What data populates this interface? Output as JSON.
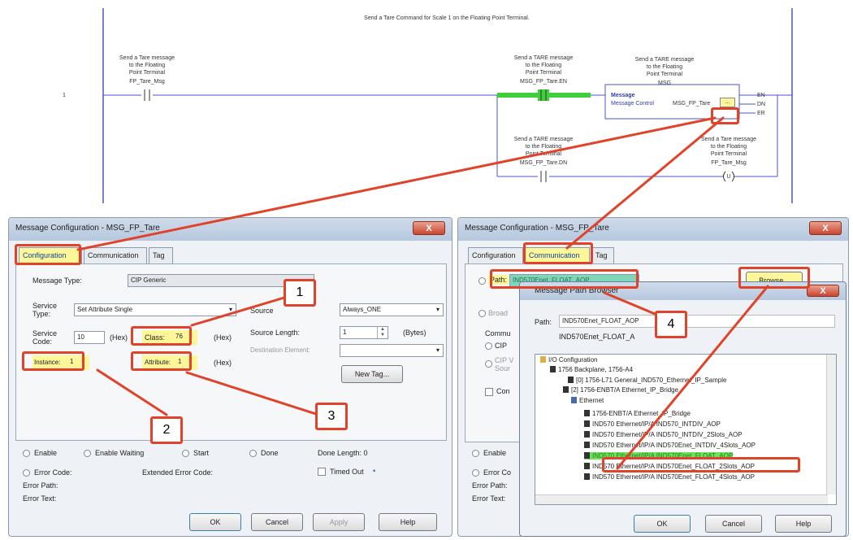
{
  "ladder": {
    "rung_comment": "Send a Tare Command for Scale 1 on the Floating Point Terminal.",
    "rung_number": "1",
    "xic1": {
      "desc": [
        "Send a Tare message",
        "to the Floating",
        "Point Terminal"
      ],
      "tag": "FP_Tare_Msg"
    },
    "xic2": {
      "desc": [
        "Send a TARE message",
        "to the Floating",
        "Point Terminal"
      ],
      "tag": "MSG_FP_Tare.EN"
    },
    "msg_block": {
      "desc": [
        "Send a TARE message",
        "to the Floating",
        "Point Terminal"
      ],
      "title": "MSG",
      "line1": "Message",
      "line2": "Message Control",
      "tag": "MSG_FP_Tare",
      "ellipsis": "...",
      "outputs": [
        "EN",
        "DN",
        "ER"
      ]
    },
    "xic3": {
      "desc": [
        "Send a TARE message",
        "to the Floating",
        "Point Terminal"
      ],
      "tag": "MSG_FP_Tare.DN"
    },
    "otu": {
      "desc": [
        "Send a Tare message",
        "to the Floating",
        "Point Terminal"
      ],
      "tag": "FP_Tare_Msg",
      "letter": "U"
    }
  },
  "left_dialog": {
    "title": "Message Configuration - MSG_FP_Tare",
    "close": "X",
    "tabs": [
      "Configuration",
      "Communication",
      "Tag"
    ],
    "message_type_label": "Message Type:",
    "message_type_value": "CIP Generic",
    "service_type_label": "Service Type:",
    "service_type_value": "Set Attribute Single",
    "service_code_label": "Service Code:",
    "service_code_value": "10",
    "hex": "(Hex)",
    "class_label": "Class:",
    "class_value": "76",
    "instance_label": "Instance:",
    "instance_value": "1",
    "attribute_label": "Attribute:",
    "attribute_value": "1",
    "source_label": "Source",
    "source_value": "Always_ONE",
    "source_length_label": "Source Length:",
    "source_length_value": "1",
    "bytes": "(Bytes)",
    "dest_label": "Destination Element:",
    "new_tag": "New Tag...",
    "status": [
      "Enable",
      "Enable Waiting",
      "Start",
      "Done"
    ],
    "done_length": "Done Length:  0",
    "error_code": "Error Code:",
    "ext_error_code": "Extended Error Code:",
    "timed_out": "Timed Out",
    "error_path": "Error Path:",
    "error_text": "Error Text:",
    "buttons": [
      "OK",
      "Cancel",
      "Apply",
      "Help"
    ]
  },
  "right_dialog": {
    "title": "Message Configuration - MSG_FP_Tare",
    "close": "X",
    "tabs": [
      "Configuration",
      "Communication",
      "Tag"
    ],
    "path_label": "Path:",
    "path_value": "IND570Enet_FLOAT_AOP",
    "browse": "Browse...",
    "broadcast": "Broad",
    "comm_method": "Commu",
    "cip": "CIP",
    "cip_via": "CIP V",
    "source": "Sour",
    "conn": "Con",
    "enable": "Enable",
    "error_code": "Error Co",
    "error_path": "Error Path:",
    "error_text": "Error Text:"
  },
  "path_browser": {
    "title": "Message Path Browser",
    "close": "X",
    "path_label": "Path:",
    "path_value": "IND570Enet_FLOAT_AOP",
    "path_sub": "IND570Enet_FLOAT_A",
    "tree": [
      "I/O Configuration",
      "1756 Backplane, 1756-A4",
      "[0] 1756-L71 General_IND570_Ethernet_IP_Sample",
      "[2] 1756-ENBT/A Ethernet_IP_Bridge",
      "Ethernet",
      "1756-ENBT/A Ethernet_IP_Bridge",
      "IND570 Ethernet/IP/A IND570_INTDIV_AOP",
      "IND570 Ethernet/IP/A IND570_INTDIV_2Slots_AOP",
      "IND570 Ethernet/IP/A IND570Enet_INTDIV_4Slots_AOP",
      "IND570 Ethernet/IP/A IND570Enet_FLOAT_AOP",
      "IND570 Ethernet/IP/A IND570Enet_FLOAT_2Slots_AOP",
      "IND570 Ethernet/IP/A IND570Enet_FLOAT_4Slots_AOP"
    ],
    "buttons": [
      "OK",
      "Cancel",
      "Help"
    ]
  },
  "callouts": [
    "1",
    "2",
    "3",
    "4"
  ],
  "colors": {
    "annotation": "#e0432a",
    "highlight": "#fdf79a",
    "selected": "#6ee05a",
    "rail": "#4a55c8"
  }
}
